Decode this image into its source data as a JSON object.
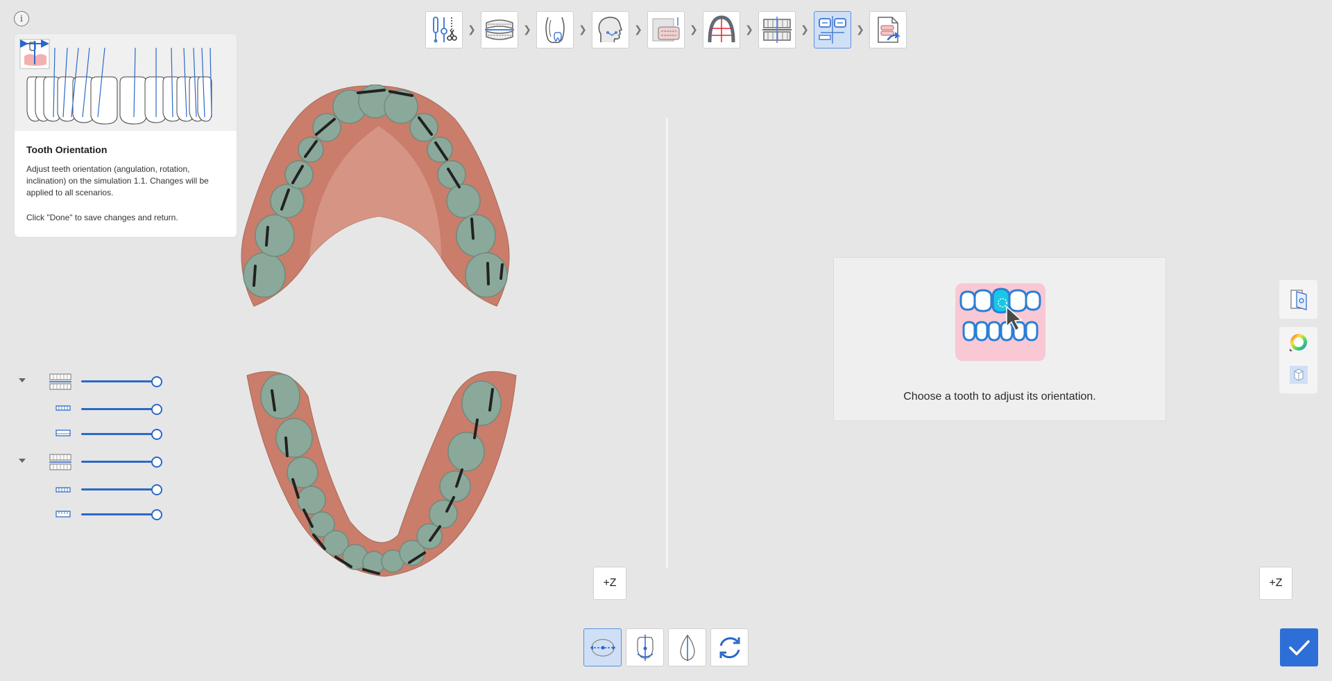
{
  "info_button": {
    "label": "i"
  },
  "workflow_steps": [
    {
      "id": "tools",
      "icon": "dental-tools-icon",
      "active": false
    },
    {
      "id": "scan-data",
      "icon": "dental-arch-scan-icon",
      "active": false
    },
    {
      "id": "tooth-numbering",
      "icon": "tooth-number-icon",
      "active": false
    },
    {
      "id": "face-profile",
      "icon": "face-profile-icon",
      "active": false
    },
    {
      "id": "photo-alignment",
      "icon": "photo-alignment-icon",
      "active": false
    },
    {
      "id": "arch-form",
      "icon": "arch-form-icon",
      "active": false
    },
    {
      "id": "occlusion",
      "icon": "occlusion-icon",
      "active": false
    },
    {
      "id": "tooth-orientation",
      "icon": "tooth-orientation-icon",
      "active": true
    },
    {
      "id": "export",
      "icon": "export-report-icon",
      "active": false
    }
  ],
  "guide": {
    "title": "Tooth Orientation",
    "description": "Adjust teeth orientation (angulation, rotation, inclination) on the simulation 1.1. Changes will be applied to all scenarios.",
    "instruction": "Click \"Done\" to save changes and return."
  },
  "visibility_sliders": [
    {
      "id": "upper-jaw",
      "icon": "upper-arch-icon",
      "collapsible": true,
      "value_pct": 100
    },
    {
      "id": "upper-teeth",
      "icon": "upper-teeth-icon",
      "collapsible": false,
      "value_pct": 100
    },
    {
      "id": "upper-gingiva",
      "icon": "upper-gingiva-icon",
      "collapsible": false,
      "value_pct": 100
    },
    {
      "id": "lower-jaw",
      "icon": "lower-arch-icon",
      "collapsible": true,
      "value_pct": 100
    },
    {
      "id": "lower-teeth",
      "icon": "lower-teeth-icon",
      "collapsible": false,
      "value_pct": 100
    },
    {
      "id": "lower-gingiva",
      "icon": "lower-gingiva-icon",
      "collapsible": false,
      "value_pct": 100
    }
  ],
  "hint": {
    "text": "Choose a tooth to adjust its orientation."
  },
  "axis_buttons": {
    "left": "+Z",
    "right": "+Z"
  },
  "side_tools": [
    "view-split-icon",
    "color-wheel-icon",
    "cube-view-icon"
  ],
  "bottom_tools": [
    {
      "id": "move",
      "icon": "move-tooth-icon",
      "active": true
    },
    {
      "id": "angulation",
      "icon": "angulation-icon",
      "active": false
    },
    {
      "id": "inclination",
      "icon": "inclination-icon",
      "active": false
    },
    {
      "id": "rotation",
      "icon": "rotation-icon",
      "active": false
    }
  ],
  "done_button": {
    "icon": "checkmark-icon"
  },
  "colors": {
    "accent": "#2d6fd6",
    "gum": "#c97d6a",
    "teeth": "#8aa99a",
    "background": "#e6e6e6"
  }
}
